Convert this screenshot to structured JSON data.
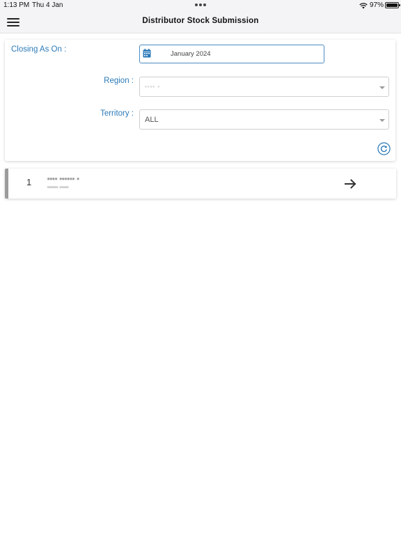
{
  "status_bar": {
    "time": "1:13 PM",
    "date": "Thu 4 Jan",
    "battery": "97%",
    "battery_level": 0.97
  },
  "header": {
    "title": "Distributor Stock Submission",
    "menu_icon": "hamburger-menu-icon"
  },
  "filters": {
    "closing_label": "Closing As On :",
    "closing_value": "January 2024",
    "region_label": "Region :",
    "region_value": "•••• •",
    "territory_label": "Territory :",
    "territory_value": "ALL",
    "refresh_icon": "refresh-icon",
    "calendar_icon": "calendar-icon"
  },
  "list": {
    "items": [
      {
        "number": "1",
        "name": "•••• •••••• •",
        "code": "•••••• •••••",
        "action_icon": "arrow-right-icon"
      }
    ]
  },
  "colors": {
    "accent": "#2b7ab8",
    "status_bar_bg": "#f4f4f6",
    "row_border": "#9b9b9b"
  }
}
